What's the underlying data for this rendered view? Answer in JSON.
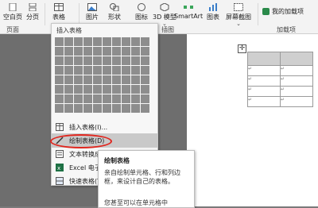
{
  "ribbon": {
    "blank_page": "空白页",
    "page_break": "分页",
    "table": "表格",
    "picture": "图片",
    "shapes": "形状",
    "icons": "图标",
    "model_3d": "3D 模型",
    "smartart": "SmartArt",
    "chart": "图表",
    "screenshot": "屏幕截图",
    "my_addins": "我的加载项",
    "groups": {
      "pages": "页面",
      "illustrations": "插图",
      "addins": "加载项"
    }
  },
  "insert_table_menu": {
    "title": "插入表格",
    "items": [
      {
        "label": "插入表格(I)..."
      },
      {
        "label": "绘制表格(D)"
      },
      {
        "label": "文本转换成表格(V)..."
      },
      {
        "label": "Excel 电子表格(X)"
      },
      {
        "label": "快速表格(T)"
      }
    ]
  },
  "tooltip": {
    "title": "绘制表格",
    "description": "亲自绘制单元格、行和列边框，来设计自己的表格。",
    "extra": "您甚至可以在单元格中"
  },
  "colors": {
    "highlight_oval": "#e0271f"
  }
}
